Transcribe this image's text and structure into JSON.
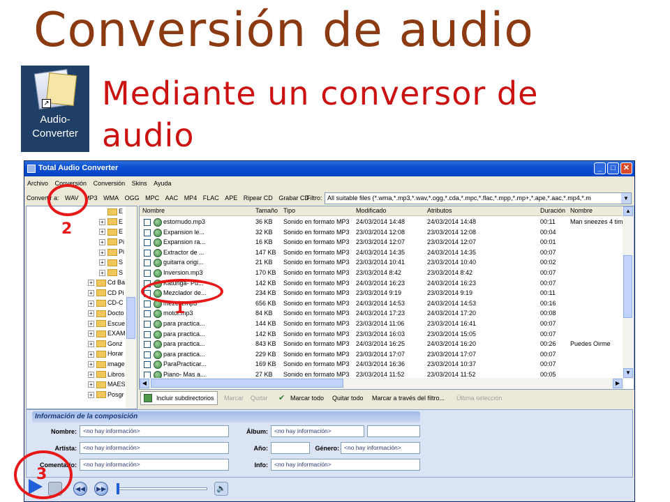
{
  "slide": {
    "title": "Conversión de audio",
    "subtitle": "Mediante un conversor de audio"
  },
  "desktop_icon": {
    "label_line1": "Audio-",
    "label_line2": "Converter",
    "icon": "audio-converter-shortcut-icon"
  },
  "window": {
    "title": "Total Audio Converter",
    "controls": [
      "minimize",
      "maximize",
      "close"
    ]
  },
  "menu": [
    "Archivo",
    "Conversión",
    "Conversión",
    "Skins",
    "Ayuda"
  ],
  "format_bar": {
    "label": "Convertir a:",
    "formats": [
      "WAV",
      "MP3",
      "WMA",
      "OGG",
      "MPC",
      "AAC",
      "MP4",
      "FLAC",
      "APE",
      "Ripear CD",
      "Grabar CD"
    ],
    "filter_label": "Filtro:",
    "filter_value": "All suitable files (*.wma,*.mp3,*.wav,*.ogg,*.cda,*.mpc,*.flac,*.mpp,*.mp+,*.ape,*.aac,*.mp4,*.m"
  },
  "tree": {
    "items": [
      {
        "label": "E",
        "expand": ""
      },
      {
        "label": "E",
        "expand": "+"
      },
      {
        "label": "E",
        "expand": "+"
      },
      {
        "label": "Pi",
        "expand": "+"
      },
      {
        "label": "Pi",
        "expand": "+"
      },
      {
        "label": "S",
        "expand": "+"
      },
      {
        "label": "S",
        "expand": "+"
      },
      {
        "label": "Cd Ba",
        "expand": "+"
      },
      {
        "label": "CD Pi",
        "expand": "+"
      },
      {
        "label": "CD-C",
        "expand": "+"
      },
      {
        "label": "Docto",
        "expand": "+"
      },
      {
        "label": "Escue",
        "expand": "+"
      },
      {
        "label": "EXAM",
        "expand": "+"
      },
      {
        "label": "Gonz",
        "expand": "+"
      },
      {
        "label": "Horar",
        "expand": "+"
      },
      {
        "label": "image",
        "expand": "+"
      },
      {
        "label": "Libros",
        "expand": "+"
      },
      {
        "label": "MAES",
        "expand": "+"
      },
      {
        "label": "Posgr",
        "expand": "+"
      }
    ]
  },
  "file_list": {
    "columns": [
      "Nombre",
      "Tamaño",
      "Tipo",
      "Modificado",
      "Atributos",
      "Duración",
      "Nombre"
    ],
    "rows": [
      {
        "name": "estornudo.mp3",
        "size": "36 KB",
        "type": "Sonido en formato MP3",
        "modified": "24/03/2014 14:48",
        "attr": "24/03/2014 14:48",
        "duration": "00:11",
        "title": "Man sneezes 4 time"
      },
      {
        "name": "Expansion le...",
        "size": "32 KB",
        "type": "Sonido en formato MP3",
        "modified": "23/03/2014 12:08",
        "attr": "23/03/2014 12:08",
        "duration": "00:04",
        "title": ""
      },
      {
        "name": "Expansion ra...",
        "size": "16 KB",
        "type": "Sonido en formato MP3",
        "modified": "23/03/2014 12:07",
        "attr": "23/03/2014 12:07",
        "duration": "00:01",
        "title": ""
      },
      {
        "name": "Extractor de ...",
        "size": "147 KB",
        "type": "Sonido en formato MP3",
        "modified": "24/03/2014 14:35",
        "attr": "24/03/2014 14:35",
        "duration": "00:07",
        "title": ""
      },
      {
        "name": "guitarra origi...",
        "size": "21 KB",
        "type": "Sonido en formato MP3",
        "modified": "23/03/2014 10:41",
        "attr": "23/03/2014 10:40",
        "duration": "00:02",
        "title": ""
      },
      {
        "name": "Inversion.mp3",
        "size": "170 KB",
        "type": "Sonido en formato MP3",
        "modified": "23/03/2014 8:42",
        "attr": "23/03/2014 8:42",
        "duration": "00:07",
        "title": ""
      },
      {
        "name": "Katunga- Pu...",
        "size": "142 KB",
        "type": "Sonido en formato MP3",
        "modified": "24/03/2014 16:23",
        "attr": "24/03/2014 16:23",
        "duration": "00:07",
        "title": ""
      },
      {
        "name": "Mezclador de...",
        "size": "234 KB",
        "type": "Sonido en formato MP3",
        "modified": "23/03/2014 9:19",
        "attr": "23/03/2014 9:19",
        "duration": "00:11",
        "title": ""
      },
      {
        "name": "mezcla.mp3",
        "size": "656 KB",
        "type": "Sonido en formato MP3",
        "modified": "24/03/2014 14:53",
        "attr": "24/03/2014 14:53",
        "duration": "00:16",
        "title": ""
      },
      {
        "name": "motor.mp3",
        "size": "84 KB",
        "type": "Sonido en formato MP3",
        "modified": "24/03/2014 17:23",
        "attr": "24/03/2014 17:20",
        "duration": "00:08",
        "title": ""
      },
      {
        "name": "para practica...",
        "size": "144 KB",
        "type": "Sonido en formato MP3",
        "modified": "23/03/2014 11:06",
        "attr": "23/03/2014 16:41",
        "duration": "00:07",
        "title": ""
      },
      {
        "name": "para practica...",
        "size": "142 KB",
        "type": "Sonido en formato MP3",
        "modified": "23/03/2014 16:03",
        "attr": "23/03/2014 15:05",
        "duration": "00:07",
        "title": ""
      },
      {
        "name": "para practica...",
        "size": "843 KB",
        "type": "Sonido en formato MP3",
        "modified": "24/03/2014 16:25",
        "attr": "24/03/2014 16:20",
        "duration": "00:26",
        "title": "Puedes Oirme"
      },
      {
        "name": "para practica...",
        "size": "229 KB",
        "type": "Sonido en formato MP3",
        "modified": "23/03/2014 17:07",
        "attr": "23/03/2014 17:07",
        "duration": "00:07",
        "title": ""
      },
      {
        "name": "ParaPracticar...",
        "size": "169 KB",
        "type": "Sonido en formato MP3",
        "modified": "24/03/2014 16:36",
        "attr": "23/03/2014 10:37",
        "duration": "00:07",
        "title": ""
      },
      {
        "name": "Piano- Mas a...",
        "size": "27 KB",
        "type": "Sonido en formato MP3",
        "modified": "23/03/2014 11:52",
        "attr": "23/03/2014 11:52",
        "duration": "00:05",
        "title": ""
      }
    ]
  },
  "selection_bar": {
    "include_subdirs": "Incluir subdirectorios",
    "mark": "Marcar",
    "remove": "Quitar",
    "mark_all": "Marcar todo",
    "remove_all": "Quitar todo",
    "mark_via_filter": "Marcar a través del filtro...",
    "last_selection": "Última selección"
  },
  "composition_info": {
    "header": "Información de la composición",
    "labels": {
      "name": "Nombre:",
      "artist": "Artista:",
      "comment": "Comentario:",
      "album": "Álbum:",
      "year": "Año:",
      "genre": "Género:",
      "info": "Info:"
    },
    "empty_value": "<no hay información>"
  },
  "annotations": [
    "1",
    "2",
    "3"
  ],
  "colors": {
    "title": "#8b3a12",
    "subtitle": "#cc1111",
    "annotation": "#e81818",
    "titlebar": "#0b4ed1"
  }
}
